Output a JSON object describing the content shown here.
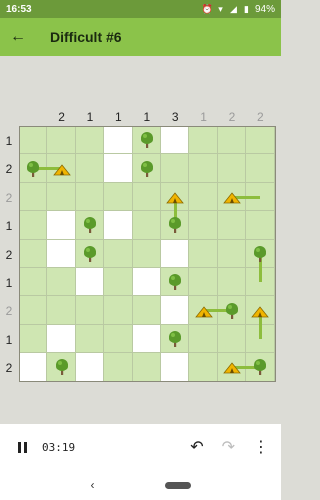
{
  "status_bar": {
    "time": "16:53",
    "battery": "94%",
    "icons": [
      "alarm-icon",
      "wifi-icon",
      "signal-icon",
      "battery-icon"
    ]
  },
  "app_bar": {
    "title": "Difficult #6",
    "back_icon": "arrow-back-icon"
  },
  "puzzle": {
    "col_hints": [
      "2",
      "1",
      "1",
      "1",
      "3",
      "1",
      "2",
      "2"
    ],
    "col_done": [
      false,
      false,
      false,
      false,
      false,
      true,
      true,
      true
    ],
    "row_hints": [
      "1",
      "2",
      "2",
      "1",
      "2",
      "1",
      "2",
      "1",
      "2"
    ],
    "row_done": [
      false,
      false,
      true,
      false,
      false,
      false,
      true,
      false,
      false
    ],
    "empty_cells": [
      [
        0,
        3
      ],
      [
        0,
        5
      ],
      [
        1,
        3
      ],
      [
        3,
        1
      ],
      [
        3,
        3
      ],
      [
        4,
        1
      ],
      [
        4,
        5
      ],
      [
        5,
        2
      ],
      [
        5,
        4
      ],
      [
        6,
        5
      ],
      [
        7,
        1
      ],
      [
        7,
        4
      ],
      [
        8,
        0
      ],
      [
        8,
        2
      ],
      [
        8,
        5
      ]
    ],
    "trees": [
      [
        0,
        4
      ],
      [
        1,
        0
      ],
      [
        1,
        4
      ],
      [
        3,
        2
      ],
      [
        3,
        5
      ],
      [
        4,
        2
      ],
      [
        4,
        8
      ],
      [
        5,
        5
      ],
      [
        6,
        7
      ],
      [
        7,
        5
      ],
      [
        8,
        1
      ],
      [
        8,
        8
      ]
    ],
    "tents": [
      [
        1,
        1
      ],
      [
        2,
        5
      ],
      [
        2,
        7
      ],
      [
        6,
        6
      ],
      [
        6,
        8
      ],
      [
        8,
        7
      ]
    ],
    "links": [
      {
        "from": [
          1,
          0
        ],
        "to": [
          1,
          1
        ]
      },
      {
        "from": [
          3,
          5
        ],
        "to": [
          2,
          5
        ]
      },
      {
        "from": [
          2,
          7
        ],
        "to": [
          2,
          8
        ]
      },
      {
        "from": [
          6,
          6
        ],
        "to": [
          6,
          7
        ]
      },
      {
        "from": [
          4,
          8
        ],
        "to": [
          5,
          8
        ]
      },
      {
        "from": [
          6,
          8
        ],
        "to": [
          7,
          8
        ]
      },
      {
        "from": [
          8,
          7
        ],
        "to": [
          8,
          8
        ]
      }
    ],
    "colors": {
      "grass": "#cfe6b2",
      "tree_leaf": "#5a9a2a",
      "tent": "#f0b400",
      "link": "#8dbd3d"
    }
  },
  "controls": {
    "timer": "03:19",
    "undo_icon": "undo-icon",
    "redo_icon": "redo-icon",
    "more_icon": "more-vert-icon",
    "pause_icon": "pause-icon"
  }
}
